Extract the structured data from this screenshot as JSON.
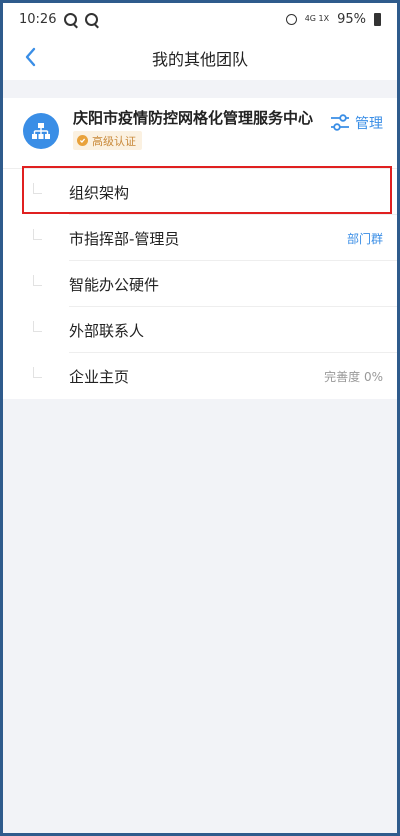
{
  "status_bar": {
    "time": "10:26",
    "network": "4G 1X",
    "battery": "95%"
  },
  "nav": {
    "title": "我的其他团队"
  },
  "team": {
    "name": "庆阳市疫情防控网格化管理服务中心",
    "badge": "高级认证",
    "manage_label": "管理",
    "accent_color": "#3a8ee6",
    "badge_color": "#e9a23b"
  },
  "menu": [
    {
      "label": "组织架构",
      "right": ""
    },
    {
      "label": "市指挥部-管理员",
      "right": "部门群"
    },
    {
      "label": "智能办公硬件",
      "right": ""
    },
    {
      "label": "外部联系人",
      "right": ""
    },
    {
      "label": "企业主页",
      "right": "完善度 0%"
    }
  ]
}
